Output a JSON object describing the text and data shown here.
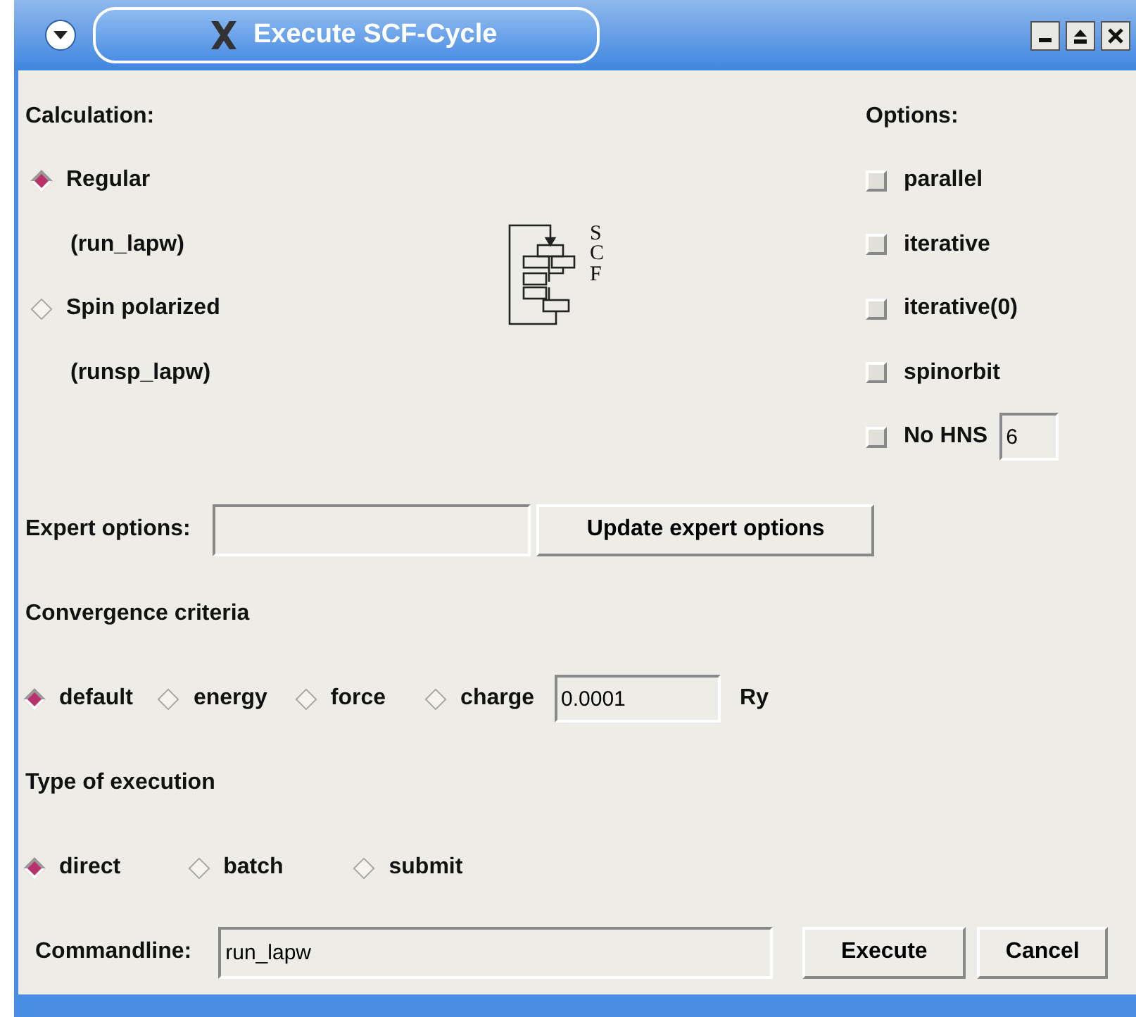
{
  "window": {
    "title": "Execute SCF-Cycle"
  },
  "calculation": {
    "label": "Calculation:",
    "options": [
      {
        "label": "Regular",
        "command": "(run_lapw)",
        "selected": true
      },
      {
        "label": "Spin polarized",
        "command": "(runsp_lapw)",
        "selected": false
      }
    ]
  },
  "scf_icon": {
    "letters": "SCF"
  },
  "options": {
    "label": "Options:",
    "items": [
      {
        "label": "parallel",
        "checked": false
      },
      {
        "label": "iterative",
        "checked": false
      },
      {
        "label": "iterative(0)",
        "checked": false
      },
      {
        "label": "spinorbit",
        "checked": false
      },
      {
        "label": "No HNS",
        "checked": false,
        "value": "6"
      }
    ]
  },
  "expert": {
    "label": "Expert options:",
    "button": "Update expert options"
  },
  "convergence": {
    "label": "Convergence criteria",
    "options": [
      {
        "label": "default",
        "selected": true
      },
      {
        "label": "energy",
        "selected": false
      },
      {
        "label": "force",
        "selected": false
      },
      {
        "label": "charge",
        "selected": false
      }
    ],
    "value": "0.0001",
    "unit": "Ry"
  },
  "execution": {
    "label": "Type of execution",
    "options": [
      {
        "label": "direct",
        "selected": true
      },
      {
        "label": "batch",
        "selected": false
      },
      {
        "label": "submit",
        "selected": false
      }
    ]
  },
  "commandline": {
    "label": "Commandline:",
    "value": "run_lapw"
  },
  "buttons": [
    "Execute",
    "Cancel"
  ]
}
